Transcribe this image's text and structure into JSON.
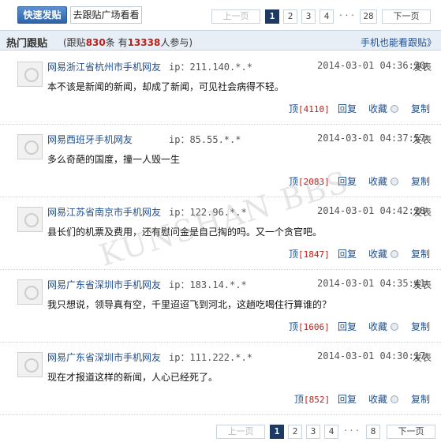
{
  "toolbar": {
    "quick_post_label": "快速发贴",
    "square_label": "去跟贴广场看看"
  },
  "pager_top": {
    "prev": "上一页",
    "pages": [
      "1",
      "2",
      "3",
      "4"
    ],
    "dots": "···",
    "last": "28",
    "next": "下一页",
    "current": "1"
  },
  "pager_bottom": {
    "prev": "上一页",
    "pages": [
      "1",
      "2",
      "3",
      "4"
    ],
    "dots": "···",
    "last": "8",
    "next": "下一页",
    "current": "1"
  },
  "header": {
    "title": "热门跟贴",
    "stats_prefix": "(跟贴",
    "posts_count": "830",
    "stats_mid": "条 有",
    "users_count": "13338",
    "stats_suffix": "人参与)",
    "mobile_link": "手机也能看跟贴》"
  },
  "watermark": "KUNSHAN BBS",
  "posts": [
    {
      "user": "网易浙江省杭州市手机网友",
      "ip": "ip：211.140.*.*",
      "time": "2014-03-01 04:36:30",
      "publish": "发表",
      "content": "本不该是新闻的新闻，却成了新闻，可见社会病得不轻。",
      "up_label": "顶",
      "up_count": "[4110]",
      "reply": "回复",
      "collect": "收藏",
      "copy": "复制"
    },
    {
      "user": "网易西班牙手机网友",
      "ip": "ip：85.55.*.*",
      "time": "2014-03-01 04:37:57",
      "publish": "发表",
      "content": "多么奇葩的国度，撞一人毁一生",
      "up_label": "顶",
      "up_count": "[2083]",
      "reply": "回复",
      "collect": "收藏",
      "copy": "复制"
    },
    {
      "user": "网易江苏省南京市手机网友",
      "ip": "ip：122.96.*.*",
      "time": "2014-03-01 04:42:28",
      "publish": "发表",
      "content": "县长们的机票及费用，还有慰问金是自己掏的吗。又一个贪官吧。",
      "up_label": "顶",
      "up_count": "[1847]",
      "reply": "回复",
      "collect": "收藏",
      "copy": "复制"
    },
    {
      "user": "网易广东省深圳市手机网友",
      "ip": "ip：183.14.*.*",
      "time": "2014-03-01 04:35:41",
      "publish": "发表",
      "content": "我只想说，领导真有空，千里迢迢飞到河北，这趟吃喝住行算谁的？",
      "up_label": "顶",
      "up_count": "[1606]",
      "reply": "回复",
      "collect": "收藏",
      "copy": "复制"
    },
    {
      "user": "网易广东省深圳市手机网友",
      "ip": "ip：111.222.*.*",
      "time": "2014-03-01 04:30:17",
      "publish": "发表",
      "content": "现在才报道这样的新闻，人心已经死了。",
      "up_label": "顶",
      "up_count": "[852]",
      "reply": "回复",
      "collect": "收藏",
      "copy": "复制"
    }
  ]
}
